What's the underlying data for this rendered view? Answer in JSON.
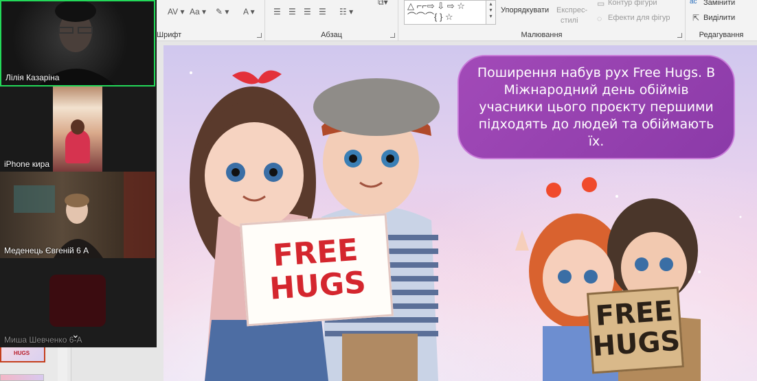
{
  "ribbon": {
    "font_group": "Шрифт",
    "paragraph_group": "Абзац",
    "drawing_group": "Малювання",
    "editing_group": "Редагування",
    "arrange_label": "Упорядкувати",
    "quick_styles_label_1": "Експрес-",
    "quick_styles_label_2": "стилі",
    "shape_outline_label": "Контур фігури",
    "shape_effects_label": "Ефекти для фігур",
    "replace_label": "Замінити",
    "select_label": "Виділити",
    "av_label": "AV",
    "aa_label": "Aa",
    "a_label": "A",
    "shape_glyphs": "△ ⌐⌐⇨ ⇩ ⇨ ☆",
    "shape_glyphs_row2": "⌒⌒⌒{ } ☆"
  },
  "participants": [
    {
      "name": "Лілія Казаріна",
      "active": true
    },
    {
      "name": "iPhone кира",
      "active": false
    },
    {
      "name": "Меденець Євгеній 6 А",
      "active": false
    },
    {
      "name": "Миша Шевченко 6-А",
      "active": false
    }
  ],
  "slide": {
    "bubble_text": "Поширення набув рух Free Hugs. В Міжнародний день обіймів учасники цього проєкту першими підходять до людей та обіймають їх.",
    "sign_main_line1": "FREE",
    "sign_main_line2": "HUGS",
    "sign_small_line1": "FREE",
    "sign_small_line2": "HUGS"
  },
  "thumbnail": {
    "label": "HUGS"
  },
  "colors": {
    "active_speaker": "#23d959",
    "bubble": "#9b45b3",
    "sign_text": "#d4262e"
  }
}
